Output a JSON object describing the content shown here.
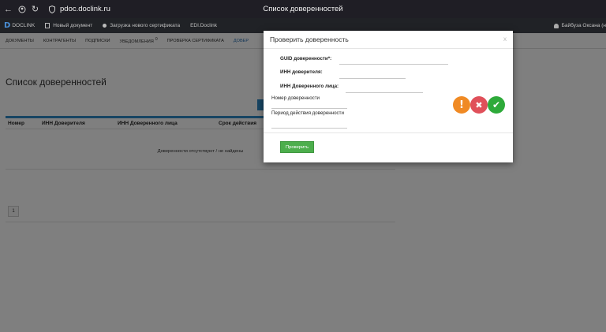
{
  "browser": {
    "url": "pdoc.doclink.ru",
    "window_title": "Список доверенностей"
  },
  "app_bar": {
    "logo": "DOCLINK",
    "items": [
      {
        "label": "Новый документ",
        "icon": "document-icon"
      },
      {
        "label": "Загрузка нового сертификата",
        "icon": "dot-icon"
      },
      {
        "label": "EDI.Doclink",
        "icon": ""
      }
    ],
    "user": "Байбуза Оксана (н"
  },
  "menu": {
    "items": [
      "ДОКУМЕНТЫ",
      "КОНТРАГЕНТЫ",
      "ПОДПИСКИ",
      "УВЕДОМЛЕНИЯ",
      "ПРОВЕРКА СЕРТИФИКАТА",
      "ДОВЕР"
    ],
    "notifications_count": "0"
  },
  "page": {
    "title": "Список доверенностей",
    "table": {
      "columns": [
        "Номер",
        "ИНН Доверителя",
        "ИНН Доверенного лица",
        "Срок действия"
      ],
      "empty_text": "Доверенности отсутствуют / не найдены"
    },
    "pager_page": "1"
  },
  "modal": {
    "title": "Проверить доверенность",
    "close": "x",
    "fields": {
      "guid_label": "GUID доверенности*:",
      "inn_principal_label": "ИНН доверителя:",
      "inn_agent_label": "ИНН Доверенного лица:",
      "number_label": "Номер доверенности",
      "period_label": "Период действия доверенности"
    },
    "status_icons": [
      "warning-icon",
      "error-icon",
      "success-icon"
    ],
    "status_colors": {
      "warning": "#f08a24",
      "error": "#e0505a",
      "success": "#2eaa3a"
    },
    "submit_label": "Проверить"
  }
}
